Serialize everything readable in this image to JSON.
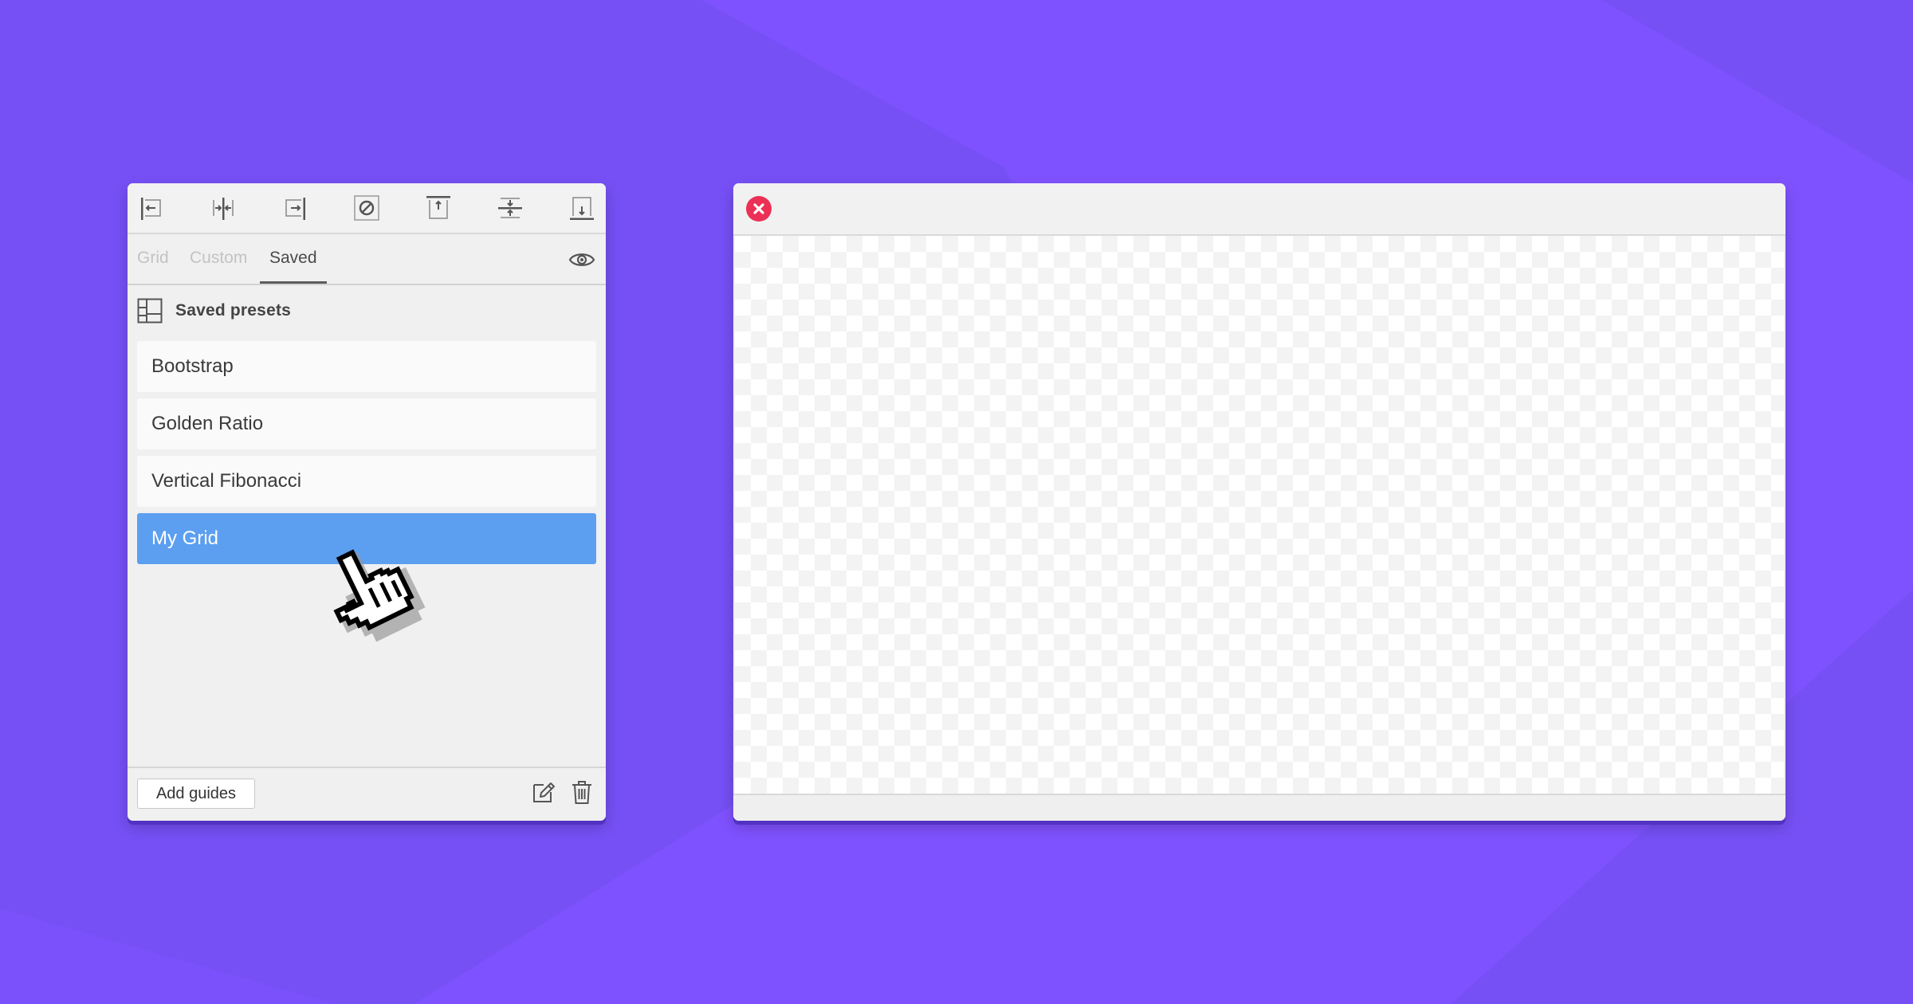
{
  "colors": {
    "background": "#7650f5",
    "background_light": "#7f52ff",
    "selection": "#5c9ff0",
    "close_button": "#ec2f55"
  },
  "panel": {
    "toolbar": [
      {
        "name": "align-left-guide-icon"
      },
      {
        "name": "align-center-vertical-guide-icon"
      },
      {
        "name": "align-right-guide-icon"
      },
      {
        "name": "clear-guides-icon"
      },
      {
        "name": "align-top-guide-icon"
      },
      {
        "name": "align-middle-horizontal-guide-icon"
      },
      {
        "name": "align-bottom-guide-icon"
      }
    ],
    "tabs": [
      {
        "label": "Grid",
        "active": false
      },
      {
        "label": "Custom",
        "active": false
      },
      {
        "label": "Saved",
        "active": true
      }
    ],
    "visibility_icon": "eye-icon",
    "section_title": "Saved presets",
    "presets": [
      {
        "label": "Bootstrap",
        "selected": false
      },
      {
        "label": "Golden Ratio",
        "selected": false
      },
      {
        "label": "Vertical Fibonacci",
        "selected": false
      },
      {
        "label": "My Grid",
        "selected": true
      }
    ],
    "footer": {
      "add_label": "Add guides",
      "edit_icon": "edit-icon",
      "delete_icon": "trash-icon"
    }
  },
  "window": {
    "close_icon": "close-icon"
  }
}
